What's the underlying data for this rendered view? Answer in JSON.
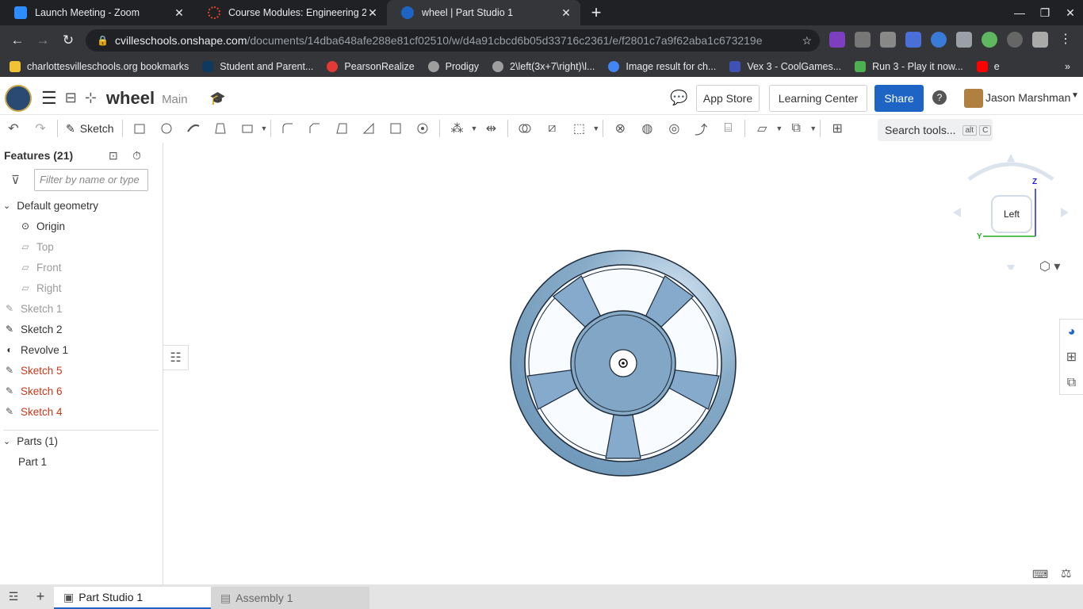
{
  "browser": {
    "tabs": [
      {
        "title": "Launch Meeting - Zoom",
        "color": "#2d8cff",
        "active": false
      },
      {
        "title": "Course Modules: Engineering 2 -",
        "color": "#e24329",
        "active": false
      },
      {
        "title": "wheel | Part Studio 1",
        "color": "#1d64c5",
        "active": true
      }
    ],
    "url_host": "cvilleschools.onshape.com",
    "url_path": "/documents/14dba648afe288e81cf02510/w/d4a91cbcd6b05d33716c2361/e/f2801c7a9f62aba1c673219e",
    "bookmarks": [
      {
        "label": "charlottesvilleschools.org bookmarks",
        "color": "#f1c232"
      },
      {
        "label": "Student and Parent...",
        "color": "#0e3a5f"
      },
      {
        "label": "PearsonRealize",
        "color": "#e53935"
      },
      {
        "label": "Prodigy",
        "color": "#9e9e9e"
      },
      {
        "label": "2\\left(3x+7\\right)\\l...",
        "color": "#9e9e9e"
      },
      {
        "label": "Image result for ch...",
        "color": "#4285f4"
      },
      {
        "label": "Vex 3 - CoolGames...",
        "color": "#3f51b5"
      },
      {
        "label": "Run 3 - Play it now...",
        "color": "#4caf50"
      },
      {
        "label": "e",
        "color": "#ff0000"
      }
    ]
  },
  "app": {
    "doc_name": "wheel",
    "branch": "Main",
    "app_store": "App Store",
    "learning_center": "Learning Center",
    "share": "Share",
    "user": "Jason Marshman",
    "sketch_label": "Sketch",
    "search_tools": "Search tools...",
    "kbd_alt": "alt",
    "kbd_c": "C"
  },
  "features": {
    "header": "Features (21)",
    "filter_placeholder": "Filter by name or type",
    "default_geometry": "Default geometry",
    "items": [
      {
        "label": "Origin",
        "state": "normal"
      },
      {
        "label": "Top",
        "state": "dim"
      },
      {
        "label": "Front",
        "state": "dim"
      },
      {
        "label": "Right",
        "state": "dim"
      },
      {
        "label": "Sketch 1",
        "state": "dim"
      },
      {
        "label": "Sketch 2",
        "state": "normal"
      },
      {
        "label": "Revolve 1",
        "state": "normal"
      },
      {
        "label": "Sketch 5",
        "state": "error"
      },
      {
        "label": "Sketch 6",
        "state": "error"
      },
      {
        "label": "Sketch 4",
        "state": "error"
      }
    ],
    "parts_header": "Parts (1)",
    "parts": [
      "Part 1"
    ]
  },
  "viewcube": {
    "label": "Left",
    "axis_z": "Z",
    "axis_y": "Y"
  },
  "bottom_tabs": [
    {
      "label": "Part Studio 1",
      "active": true
    },
    {
      "label": "Assembly 1",
      "active": false
    }
  ]
}
